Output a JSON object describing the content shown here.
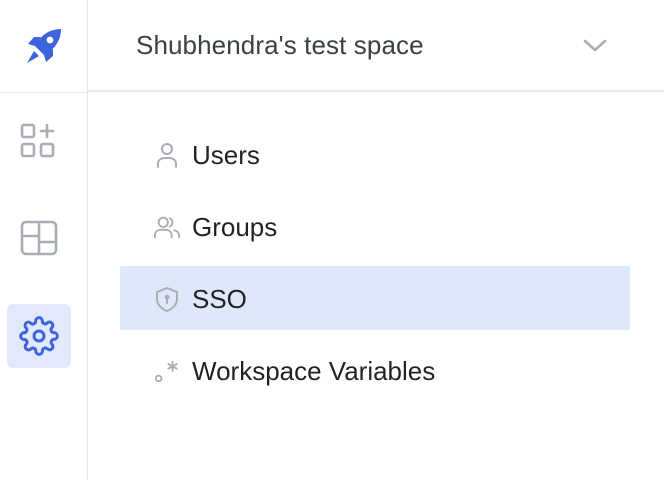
{
  "header": {
    "workspace_name": "Shubhendra's test space"
  },
  "rail": {
    "items": [
      {
        "icon": "apps-add-icon",
        "active": false
      },
      {
        "icon": "layout-icon",
        "active": false
      },
      {
        "icon": "gear-icon",
        "active": true
      }
    ]
  },
  "menu": {
    "items": [
      {
        "label": "Users",
        "icon": "user-icon",
        "active": false
      },
      {
        "label": "Groups",
        "icon": "users-icon",
        "active": false
      },
      {
        "label": "SSO",
        "icon": "shield-lock-icon",
        "active": true
      },
      {
        "label": "Workspace Variables",
        "icon": "variable-icon",
        "active": false
      }
    ]
  },
  "colors": {
    "accent": "#3e63dd",
    "active_bg": "#dfe7fb",
    "icon_gray": "#a9aeb4",
    "text": "#1f2328"
  }
}
